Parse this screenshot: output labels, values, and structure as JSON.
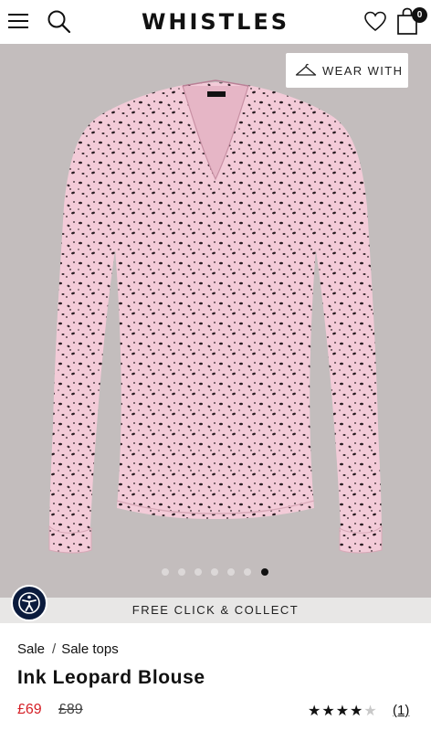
{
  "header": {
    "brand": "WHISTLES",
    "bag_count": "0",
    "icons": [
      "menu-icon",
      "search-icon",
      "heart-icon",
      "bag-icon"
    ]
  },
  "gallery": {
    "wear_with_label": "WEAR WITH",
    "wear_with_icon": "hanger-icon",
    "dot_count": 7,
    "active_dot": 7,
    "background_color": "#c3bdbd",
    "garment_color": "#f3cbd8"
  },
  "accessibility_icon": "accessibility-icon",
  "promo_banner": "FREE CLICK & COLLECT",
  "breadcrumb": {
    "items": [
      "Sale",
      "Sale tops"
    ],
    "separator": "/"
  },
  "product": {
    "title": "Ink Leopard Blouse",
    "sale_price": "£69",
    "original_price": "£89",
    "rating": 4,
    "rating_max": 5,
    "review_count": "(1)"
  },
  "colors": {
    "sale_red": "#d51f26",
    "accessibility_navy": "#0b1b3d"
  }
}
